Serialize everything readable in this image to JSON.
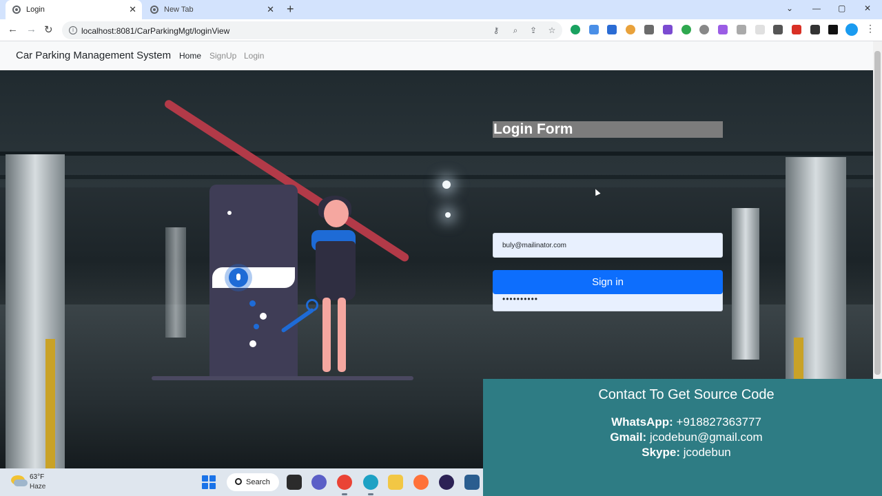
{
  "browser": {
    "tabs": [
      {
        "label": "Login",
        "active": true
      },
      {
        "label": "New Tab",
        "active": false
      }
    ],
    "new_tab_symbol": "+",
    "close_symbol": "✕",
    "window_controls": [
      "⌄",
      "—",
      "▢",
      "✕"
    ],
    "url": "localhost:8081/CarParkingMgt/loginView",
    "nav_icons": [
      "back-arrow-icon",
      "forward-arrow-icon",
      "reload-icon"
    ],
    "omnibox_icons": [
      "key-icon",
      "zoom-icon",
      "share-icon",
      "star-icon"
    ]
  },
  "navbar": {
    "brand": "Car Parking Management System",
    "links": [
      "Home",
      "SignUp",
      "Login"
    ]
  },
  "form": {
    "title": "Login Form",
    "email_value": "buly@mailinator.com",
    "password_value": "••••••••••",
    "signin_label": "Sign in"
  },
  "contact": {
    "title": "Contact To Get Source Code",
    "whatsapp_label": "WhatsApp:",
    "whatsapp_value": "+918827363777",
    "gmail_label": "Gmail:",
    "gmail_value": "jcodebun@gmail.com",
    "skype_label": "Skype:",
    "skype_value": "jcodebun"
  },
  "taskbar": {
    "temperature": "63°F",
    "condition": "Haze",
    "search_label": "Search"
  },
  "colors": {
    "accent": "#0d6efd",
    "contact_bg": "#2e7c84",
    "tabbar_bg": "#d3e3fd",
    "illustration_blue": "#1e6bd6"
  }
}
